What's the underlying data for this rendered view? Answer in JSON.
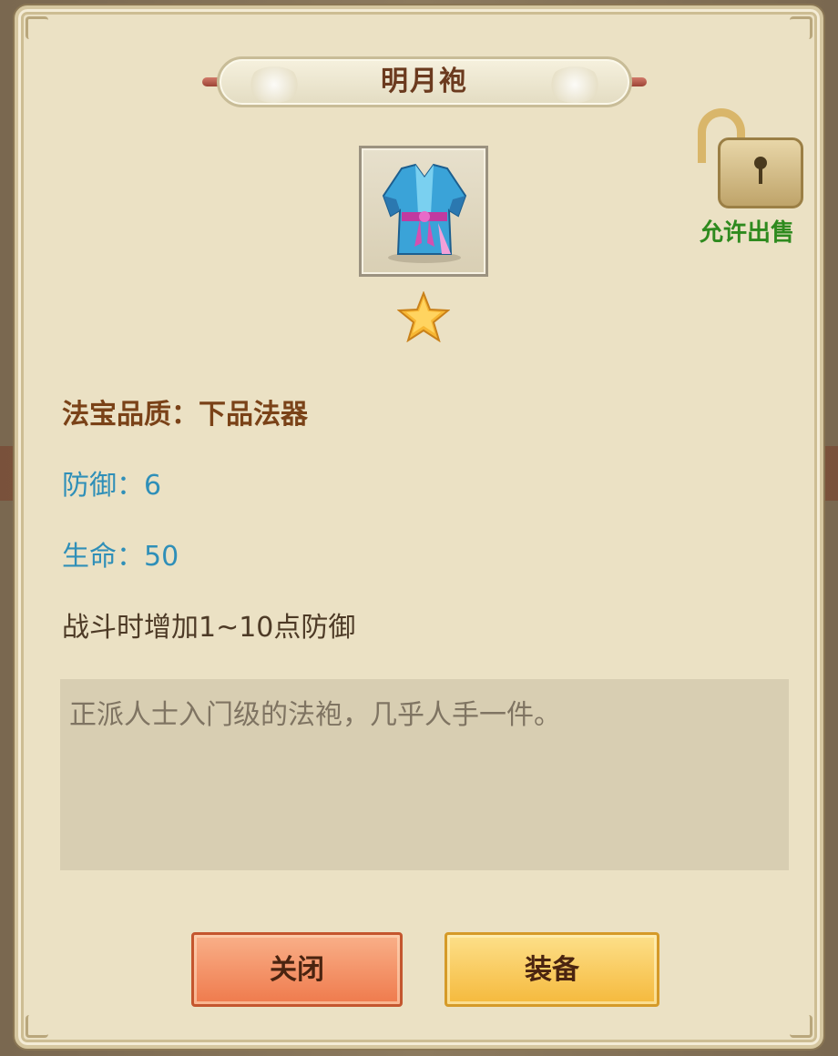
{
  "dialog": {
    "title": "明月袍",
    "sell_status": "允许出售",
    "item_icon": "blue-robe-icon",
    "star_icon": "star-icon",
    "stars": 1
  },
  "stats": {
    "quality": "法宝品质：下品法器",
    "defense": "防御：6",
    "hp": "生命：50",
    "effect": "战斗时增加1~10点防御"
  },
  "description": "正派人士入门级的法袍，几乎人手一件。",
  "buttons": {
    "close_label": "关闭",
    "equip_label": "装备"
  },
  "colors": {
    "panel": "#ebe1c4",
    "quality_text": "#7a4218",
    "stat_text": "#2f8fb8",
    "sell_text": "#2e8a1e",
    "close_button": "#ef7a4c",
    "equip_button": "#f5b93c"
  }
}
